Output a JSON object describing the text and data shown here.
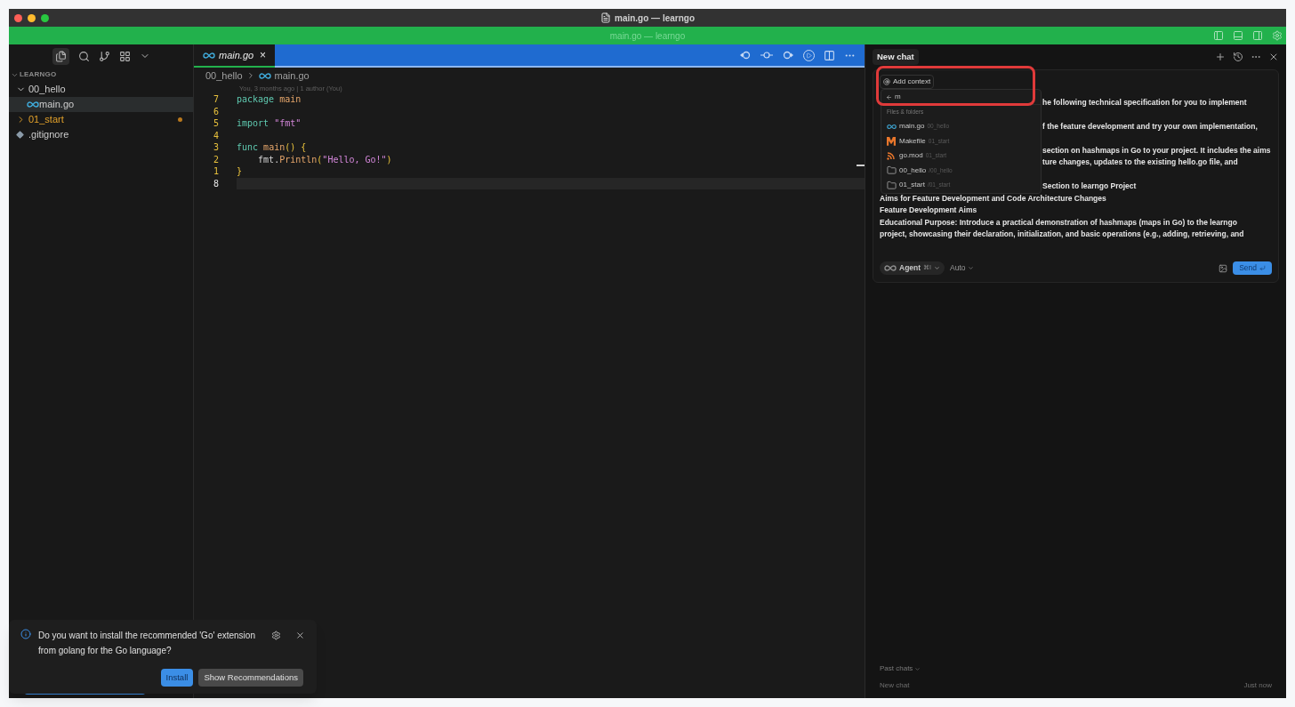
{
  "window": {
    "title": "main.go — learngo",
    "subtitle": "main.go — learngo"
  },
  "sidebar": {
    "section": "LEARNGO",
    "tree": [
      {
        "label": "00_hello",
        "kind": "folder",
        "expanded": true,
        "modified": false,
        "selected": false,
        "children": [
          {
            "label": "main.go",
            "kind": "go",
            "selected": true,
            "modified": false
          }
        ]
      },
      {
        "label": "01_start",
        "kind": "folder",
        "expanded": false,
        "modified": true,
        "selected": false
      },
      {
        "label": ".gitignore",
        "kind": "git",
        "selected": false,
        "modified": false
      }
    ]
  },
  "editor": {
    "tab": {
      "label": "main.go",
      "close": "×"
    },
    "breadcrumb": [
      "00_hello",
      "main.go"
    ],
    "blame": "You, 3 months ago | 1 author (You)",
    "lines": [
      {
        "number": "7",
        "current": false,
        "tokens": [
          {
            "text": "package ",
            "kind": "keyword"
          },
          {
            "text": "main",
            "kind": "name"
          }
        ]
      },
      {
        "number": "6",
        "current": false
      },
      {
        "number": "5",
        "current": false,
        "tokens": [
          {
            "text": "import ",
            "kind": "keyword"
          },
          {
            "text": "\"fmt\"",
            "kind": "string"
          }
        ]
      },
      {
        "number": "4",
        "current": false
      },
      {
        "number": "3",
        "current": false,
        "tokens": [
          {
            "text": "func ",
            "kind": "keyword"
          },
          {
            "text": "main",
            "kind": "name"
          },
          {
            "text": "() {",
            "kind": "brace"
          }
        ]
      },
      {
        "number": "2",
        "current": false,
        "tokens": [
          {
            "text": "    fmt.",
            "kind": "plain"
          },
          {
            "text": "Println",
            "kind": "name"
          },
          {
            "text": "(",
            "kind": "brace"
          },
          {
            "text": "\"Hello, Go!\"",
            "kind": "string"
          },
          {
            "text": ")",
            "kind": "brace"
          }
        ]
      },
      {
        "number": "1",
        "current": false,
        "tokens": [
          {
            "text": "}",
            "kind": "brace"
          }
        ]
      },
      {
        "number": "8",
        "current": true
      }
    ]
  },
  "chat": {
    "tab": "New chat",
    "add_context": "Add context",
    "search_value": "m",
    "dropdown_heading": "Files & folders",
    "dropdown_items": [
      {
        "name": "main.go",
        "path": "00_hello",
        "kind": "go"
      },
      {
        "name": "Makefile",
        "path": "01_start",
        "kind": "makefile"
      },
      {
        "name": "go.mod",
        "path": "01_start",
        "kind": "gomod"
      },
      {
        "name": "00_hello",
        "path": "/00_hello",
        "kind": "folder"
      },
      {
        "name": "01_start",
        "path": "/01_start",
        "kind": "folder"
      }
    ],
    "message_beside_dropdown": [
      [
        "he following technical specification for you to implement"
      ],
      [
        "f the feature development and try your own implementation,"
      ],
      [
        "section on hashmaps in Go to your project. It includes the aims",
        "ture changes, updates to the existing hello.go file, and"
      ],
      [
        "Section to learngo Project"
      ]
    ],
    "message_lines": [
      "Aims for Feature Development and Code Architecture Changes",
      "Feature Development Aims",
      "Educational Purpose: Introduce a practical demonstration of hashmaps (maps in Go) to the learngo",
      "project, showcasing their declaration, initialization, and basic operations (e.g., adding, retrieving, and"
    ],
    "mode": "Agent",
    "mode_shortcut": "⌘I",
    "model": "Auto",
    "send": "Send",
    "past_chats": "Past chats",
    "history": [
      {
        "title": "New chat",
        "time": "Just now"
      }
    ]
  },
  "notification": {
    "message": "Do you want to install the recommended 'Go' extension from golang for the Go language?",
    "buttons": [
      {
        "label": "Install",
        "primary": true
      },
      {
        "label": "Show Recommendations",
        "primary": false
      }
    ]
  }
}
